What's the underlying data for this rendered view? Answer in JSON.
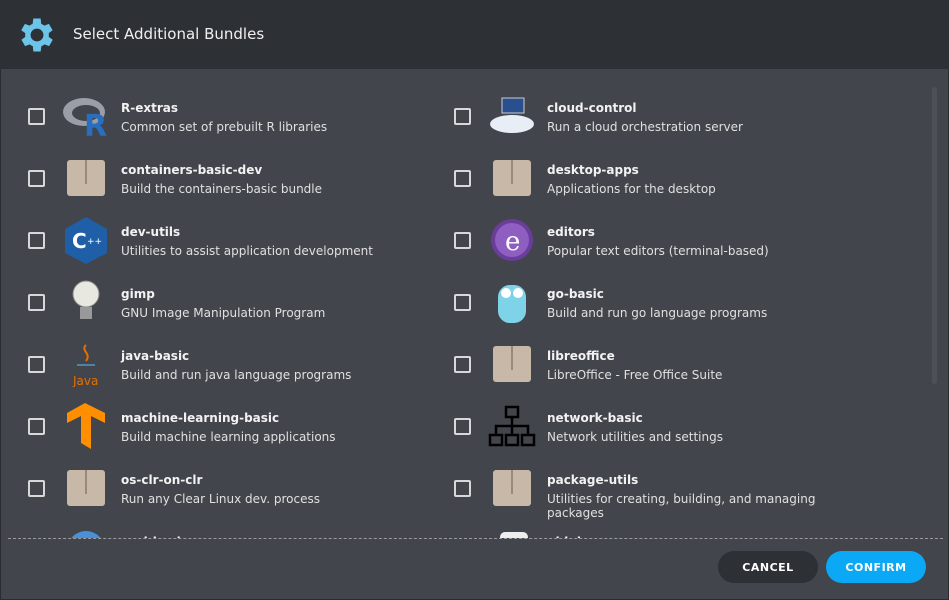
{
  "header": {
    "title": "Select Additional Bundles",
    "icon": "gear-icon",
    "icon_color": "#6cc4e8"
  },
  "bundles": [
    {
      "name": "R-extras",
      "desc": "Common set of prebuilt R libraries",
      "icon": "r-logo-icon"
    },
    {
      "name": "cloud-control",
      "desc": "Run a cloud orchestration server",
      "icon": "cloud-computer-icon"
    },
    {
      "name": "containers-basic-dev",
      "desc": "Build the containers-basic bundle",
      "icon": "package-icon"
    },
    {
      "name": "desktop-apps",
      "desc": "Applications for the desktop",
      "icon": "package-icon"
    },
    {
      "name": "dev-utils",
      "desc": "Utilities to assist application development",
      "icon": "cpp-logo-icon"
    },
    {
      "name": "editors",
      "desc": "Popular text editors (terminal-based)",
      "icon": "emacs-icon"
    },
    {
      "name": "gimp",
      "desc": "GNU Image Manipulation Program",
      "icon": "lightbulb-icon"
    },
    {
      "name": "go-basic",
      "desc": "Build and run go language programs",
      "icon": "gopher-icon"
    },
    {
      "name": "java-basic",
      "desc": "Build and run java language programs",
      "icon": "java-logo-icon"
    },
    {
      "name": "libreoffice",
      "desc": "LibreOffice - Free Office Suite",
      "icon": "package-icon"
    },
    {
      "name": "machine-learning-basic",
      "desc": "Build machine learning applications",
      "icon": "tensorflow-icon"
    },
    {
      "name": "network-basic",
      "desc": "Network utilities and settings",
      "icon": "network-icon"
    },
    {
      "name": "os-clr-on-clr",
      "desc": "Run any Clear Linux dev. process",
      "icon": "package-icon"
    },
    {
      "name": "package-utils",
      "desc": "Utilities for creating, building, and managing packages",
      "icon": "package-icon"
    },
    {
      "name": "perl-basic",
      "desc": "",
      "icon": "perl-icon"
    },
    {
      "name": "pidgin",
      "desc": "",
      "icon": "pidgin-icon"
    }
  ],
  "footer": {
    "cancel": "CANCEL",
    "confirm": "CONFIRM"
  }
}
